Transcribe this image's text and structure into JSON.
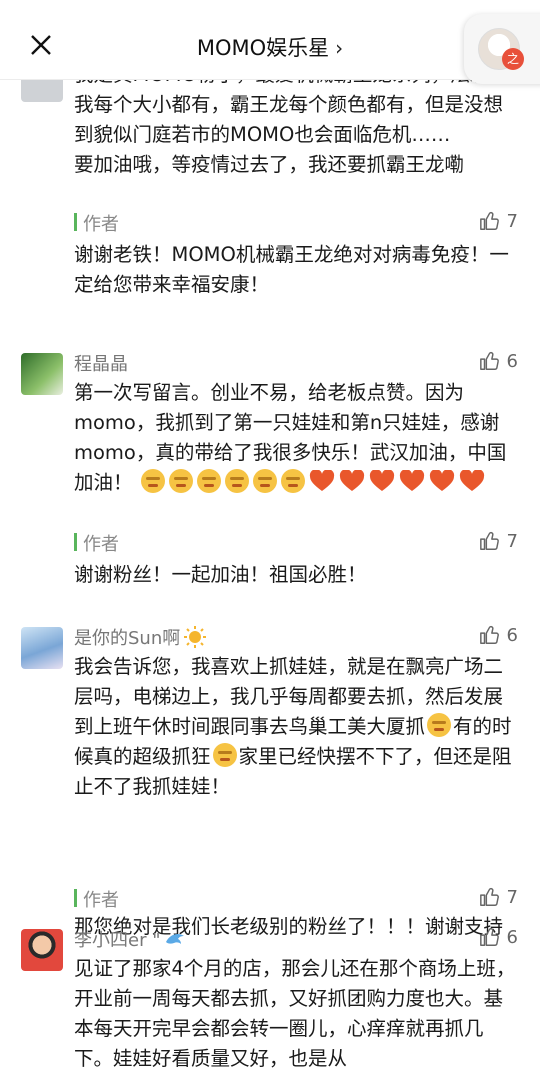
{
  "navbar": {
    "title": "MOMO娱乐星",
    "chevron": "›",
    "close_icon": "close-icon",
    "mini_program_badge": "之"
  },
  "author_label": "作者",
  "comments": [
    {
      "user": "",
      "avatar_color": "#cfd2d6",
      "likes": "",
      "text": "我是真MOMO粉了，最爱机械霸王龙系列，炫彩的我每个大小都有，霸王龙每个颜色都有，但是没想到貌似门庭若市的MOMO也会面临危机……\n要加油哦，等疫情过去了，我还要抓霸王龙嘞",
      "reply_likes": "7",
      "reply": "谢谢老铁！MOMO机械霸王龙绝对对病毒免疫！一定给您带来幸福安康！"
    },
    {
      "user": "程晶晶",
      "avatar_color": "#4f8a3d",
      "likes": "6",
      "text": "第一次写留言。创业不易，给老板点赞。因为momo，我抓到了第一只娃娃和第n只娃娃，感谢momo，真的带给了我很多快乐！武汉加油，中国加油！",
      "reply_likes": "7",
      "reply": "谢谢粉丝！一起加油！祖国必胜！"
    },
    {
      "user": "是你的Sun啊",
      "avatar_color": "#8fb3d9",
      "likes": "6",
      "text_a": "我会告诉您，我喜欢上抓娃娃，就是在飘亮广场二层吗，电梯边上，我几乎每周都要去抓，然后发展到上班午休时间跟同事去鸟巢工美大厦抓",
      "text_b": "有的时候真的超级抓狂",
      "text_c": "家里已经快摆不下了，但还是阻止不了我抓娃娃！",
      "reply_likes": "7",
      "reply": "那您绝对是我们长老级别的粉丝了！！！谢谢支持"
    },
    {
      "user": "李小四er \"",
      "avatar_color": "#e2483d",
      "likes": "6",
      "text": "见证了那家4个月的店，那会儿还在那个商场上班，开业前一周每天都去抓，又好抓团购力度也大。基本每天开完早会都会转一圈儿，心痒痒就再抓几下。娃娃好看质量又好，也是从"
    }
  ]
}
